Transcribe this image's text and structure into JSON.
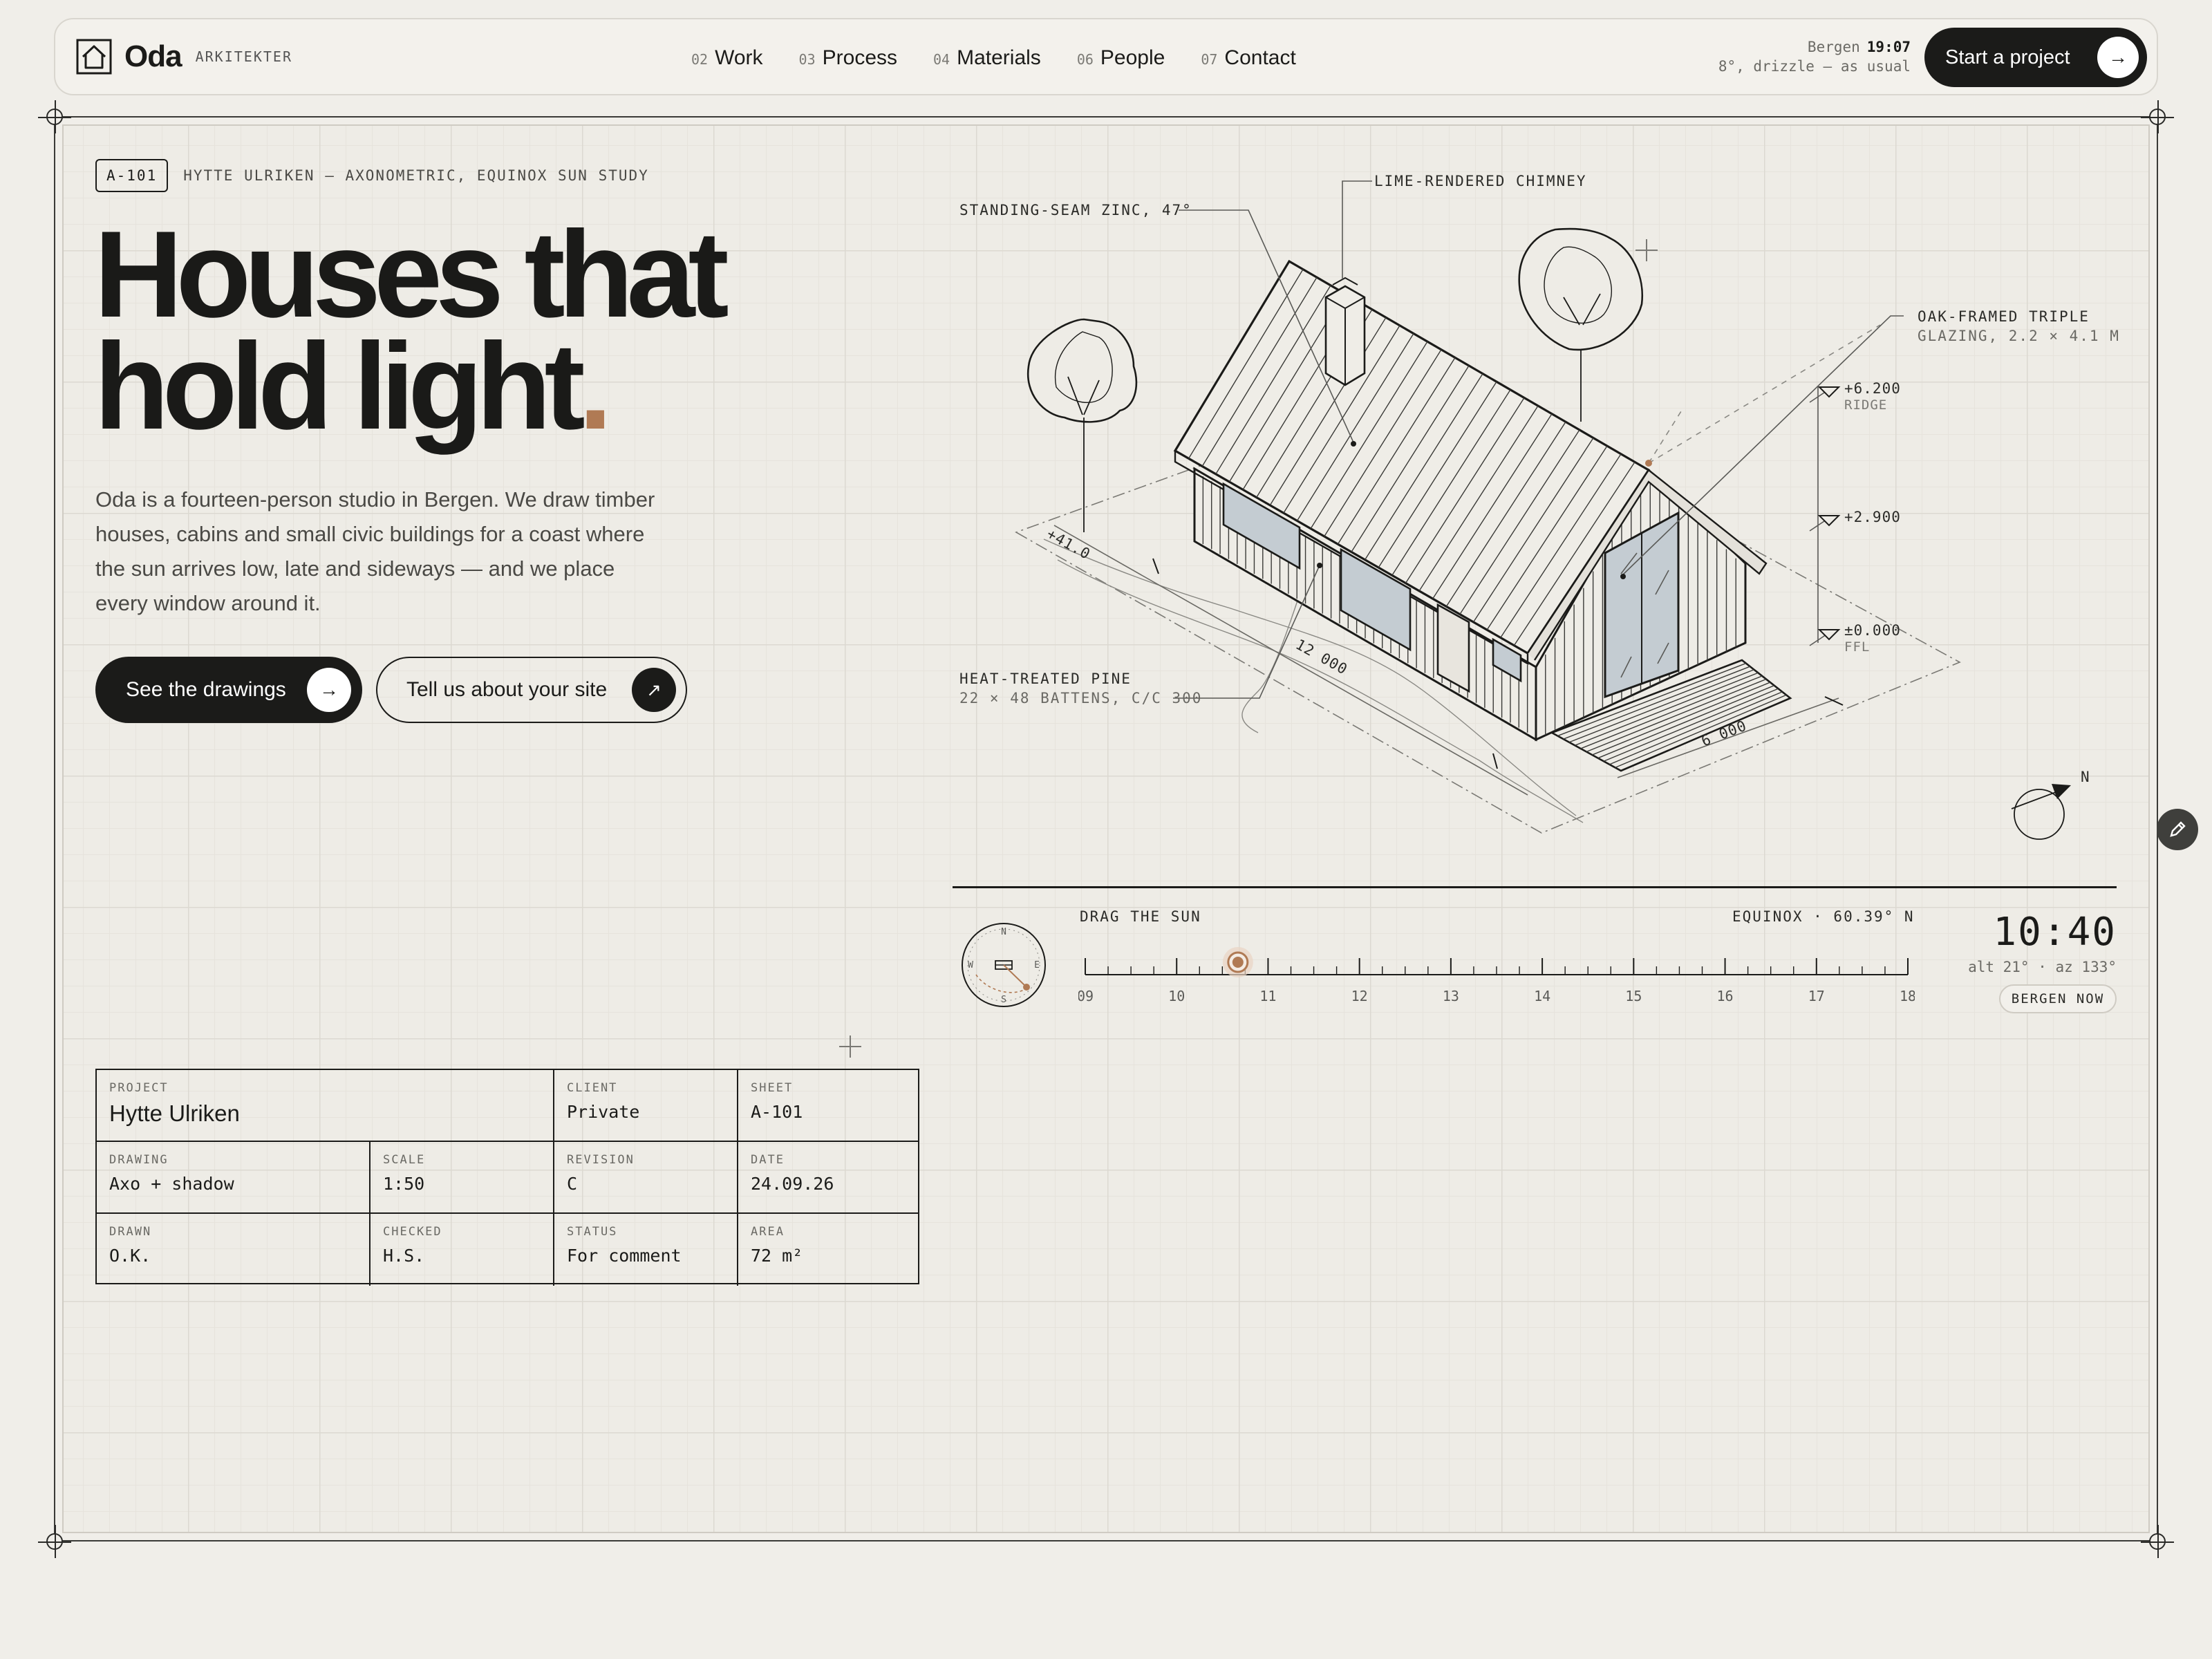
{
  "brand": {
    "name": "Oda",
    "subtitle": "ARKITEKTER"
  },
  "nav": [
    {
      "num": "02",
      "label": "Work"
    },
    {
      "num": "03",
      "label": "Process"
    },
    {
      "num": "04",
      "label": "Materials"
    },
    {
      "num": "06",
      "label": "People"
    },
    {
      "num": "07",
      "label": "Contact"
    }
  ],
  "weather": {
    "city": "Bergen",
    "time": "19:07",
    "conditions": "8°, drizzle — as usual"
  },
  "cta": {
    "label": "Start a project",
    "icon": "arrow-right-icon"
  },
  "sheet": {
    "code": "A-101",
    "description": "HYTTE ULRIKEN — AXONOMETRIC, EQUINOX SUN STUDY"
  },
  "hero": {
    "title_line1": "Houses that",
    "title_line2": "hold light",
    "title_dot": ".",
    "body": "Oda is a fourteen-person studio in Bergen. We draw timber houses, cabins and small civic buildings for a coast where the sun arrives low, late and sideways — and we place every window around it.",
    "primary_button": "See the drawings",
    "secondary_button": "Tell us about your site"
  },
  "callouts": {
    "chimney": "LIME-RENDERED CHIMNEY",
    "roof": "STANDING-SEAM ZINC, 47°",
    "glazing_1": "OAK-FRAMED TRIPLE",
    "glazing_2": "GLAZING, 2.2 × 4.1 M",
    "pine_1": "HEAT-TREATED PINE",
    "pine_2": "22 × 48 BATTENS, C/C 300"
  },
  "levels": [
    {
      "value": "+6.200",
      "label": "RIDGE"
    },
    {
      "value": "+2.900",
      "label": ""
    },
    {
      "value": "±0.000",
      "label": "FFL"
    }
  ],
  "dimensions": {
    "length": "12 000",
    "width": "6 000",
    "ground": "+41.0"
  },
  "north_label": "N",
  "sun": {
    "label": "DRAG THE SUN",
    "latitude": "EQUINOX · 60.39° N",
    "hours": [
      "09",
      "10",
      "11",
      "12",
      "13",
      "14",
      "15",
      "16",
      "17",
      "18"
    ],
    "current_hour": 10.67,
    "time": "10:40",
    "altitude": "alt 21° · az 133°",
    "now_button": "BERGEN NOW",
    "compass": {
      "n": "N",
      "s": "S",
      "e": "E",
      "w": "W"
    }
  },
  "title_block": {
    "project_label": "PROJECT",
    "project": "Hytte Ulriken",
    "client_label": "CLIENT",
    "client": "Private",
    "sheet_label": "SHEET",
    "sheet": "A-101",
    "drawing_label": "DRAWING",
    "drawing": "Axo + shadow",
    "scale_label": "SCALE",
    "scale": "1:50",
    "revision_label": "REVISION",
    "revision": "C",
    "date_label": "DATE",
    "date": "24.09.26",
    "drawn_label": "DRAWN",
    "drawn": "O.K.",
    "checked_label": "CHECKED",
    "checked": "H.S.",
    "status_label": "STATUS",
    "status": "For comment",
    "area_label": "AREA",
    "area": "72 m²"
  },
  "colors": {
    "accent": "#b07a54",
    "ink": "#1b1b19",
    "paper": "#f0eee9",
    "glass": "#c4ccd2"
  }
}
